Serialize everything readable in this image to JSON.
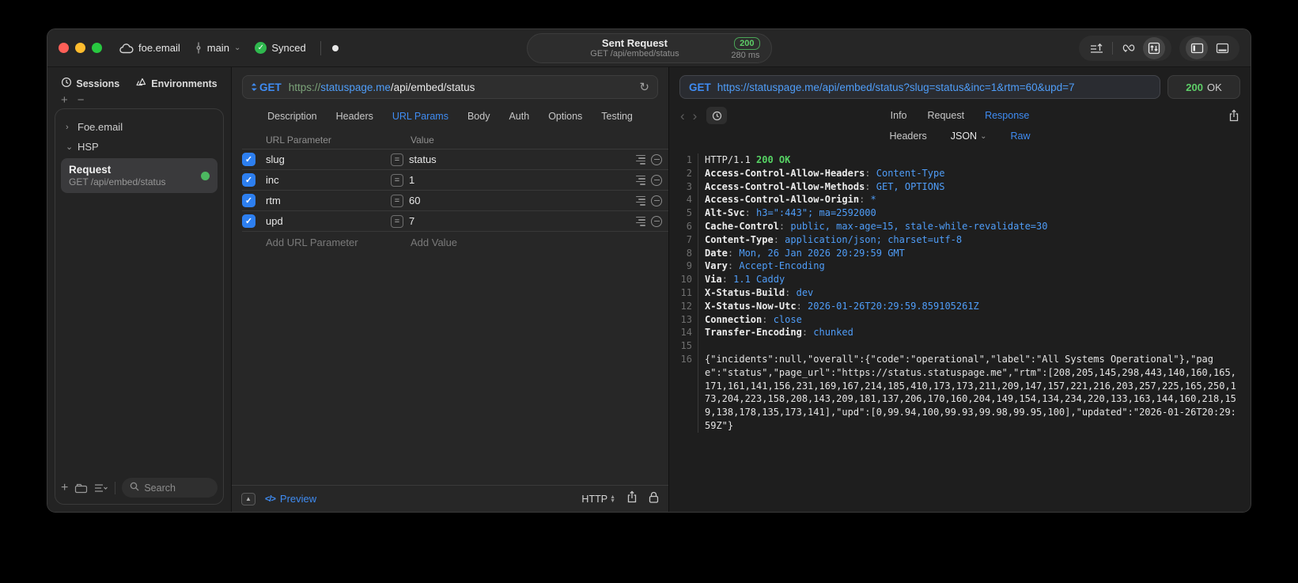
{
  "colors": {
    "accent_blue": "#3f8cf3",
    "link_blue": "#4f9df8",
    "green": "#56d364",
    "badge_green": "#5ecf68"
  },
  "titlebar": {
    "project": "foe.email",
    "branch": "main",
    "sync_status": "Synced",
    "capsule": {
      "title": "Sent Request",
      "subtitle": "GET /api/embed/status",
      "status_code": "200",
      "duration": "280 ms"
    }
  },
  "sidebar": {
    "tabs": [
      {
        "label": "Sessions"
      },
      {
        "label": "Environments"
      }
    ],
    "tree": [
      {
        "label": "Foe.email",
        "expanded": false
      },
      {
        "label": "HSP",
        "expanded": true
      }
    ],
    "request_item": {
      "title": "Request",
      "subtitle": "GET /api/embed/status"
    },
    "search_placeholder": "Search"
  },
  "request_pane": {
    "method": "GET",
    "url_scheme": "https://",
    "url_host": "statuspage.me",
    "url_path": "/api/embed/status",
    "tabs": [
      "Description",
      "Headers",
      "URL Params",
      "Body",
      "Auth",
      "Options",
      "Testing"
    ],
    "active_tab_index": 2,
    "params_table": {
      "columns": [
        "URL Parameter",
        "Value"
      ],
      "rows": [
        {
          "enabled": true,
          "name": "slug",
          "value": "status"
        },
        {
          "enabled": true,
          "name": "inc",
          "value": "1"
        },
        {
          "enabled": true,
          "name": "rtm",
          "value": "60"
        },
        {
          "enabled": true,
          "name": "upd",
          "value": "7"
        }
      ],
      "add_name_placeholder": "Add URL Parameter",
      "add_value_placeholder": "Add Value"
    },
    "bottom_bar": {
      "preview_label": "Preview",
      "protocol": "HTTP"
    }
  },
  "response_pane": {
    "method": "GET",
    "url": "https://statuspage.me/api/embed/status?slug=status&inc=1&rtm=60&upd=7",
    "status_code": "200",
    "status_text": "OK",
    "tabs": [
      "Info",
      "Request",
      "Response"
    ],
    "active_tab_index": 2,
    "view_tabs": [
      "Headers",
      "JSON",
      "Raw"
    ],
    "active_view_index": 2,
    "raw": {
      "status_line": {
        "prefix": "HTTP/1.1 ",
        "status": "200 OK"
      },
      "headers": [
        {
          "name": "Access-Control-Allow-Headers",
          "value": "Content-Type"
        },
        {
          "name": "Access-Control-Allow-Methods",
          "value": "GET, OPTIONS"
        },
        {
          "name": "Access-Control-Allow-Origin",
          "value": "*"
        },
        {
          "name": "Alt-Svc",
          "value": "h3=\":443\"; ma=2592000"
        },
        {
          "name": "Cache-Control",
          "value": "public, max-age=15, stale-while-revalidate=30"
        },
        {
          "name": "Content-Type",
          "value": "application/json; charset=utf-8"
        },
        {
          "name": "Date",
          "value": "Mon, 26 Jan 2026 20:29:59 GMT"
        },
        {
          "name": "Vary",
          "value": "Accept-Encoding"
        },
        {
          "name": "Via",
          "value": "1.1 Caddy"
        },
        {
          "name": "X-Status-Build",
          "value": "dev"
        },
        {
          "name": "X-Status-Now-Utc",
          "value": "2026-01-26T20:29:59.859105261Z"
        },
        {
          "name": "Connection",
          "value": "close"
        },
        {
          "name": "Transfer-Encoding",
          "value": "chunked"
        }
      ],
      "body": "{\"incidents\":null,\"overall\":{\"code\":\"operational\",\"label\":\"All Systems Operational\"},\"page\":\"status\",\"page_url\":\"https://status.statuspage.me\",\"rtm\":[208,205,145,298,443,140,160,165,171,161,141,156,231,169,167,214,185,410,173,173,211,209,147,157,221,216,203,257,225,165,250,173,204,223,158,208,143,209,181,137,206,170,160,204,149,154,134,234,220,133,163,144,160,218,159,138,178,135,173,141],\"upd\":[0,99.94,100,99.93,99.98,99.95,100],\"updated\":\"2026-01-26T20:29:59Z\"}"
    }
  }
}
